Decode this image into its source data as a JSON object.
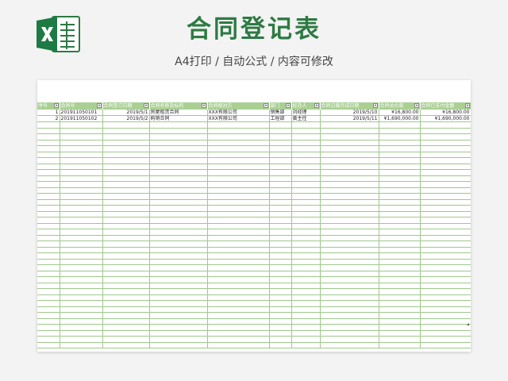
{
  "app_icon": "excel-icon",
  "brand_color": "#2d7a43",
  "header_color": "#a9cf93",
  "header": {
    "title": "合同登记表",
    "subtitle": "A4打印 / 自动公式 / 内容可修改"
  },
  "table": {
    "columns": [
      "序号",
      "合同号",
      "合同签订日期",
      "合同名称及标的",
      "合同相对方",
      "部门",
      "经办人",
      "合同记载完成日期",
      "合同总价款",
      "合同已支付金额"
    ],
    "rows": [
      [
        "1",
        "201911050101",
        "2019/5/1",
        "房屋租赁合同",
        "XXX有限公司",
        "销售部",
        "刘经理",
        "2019/5/10",
        "¥16,800.00",
        "¥16,800.00"
      ],
      [
        "2",
        "201911050102",
        "2019/5/2",
        "购销合同",
        "XXX有限公司",
        "工程部",
        "黄主任",
        "2019/5/11",
        "¥1,690,000.00",
        "¥1,690,000.00"
      ]
    ]
  }
}
